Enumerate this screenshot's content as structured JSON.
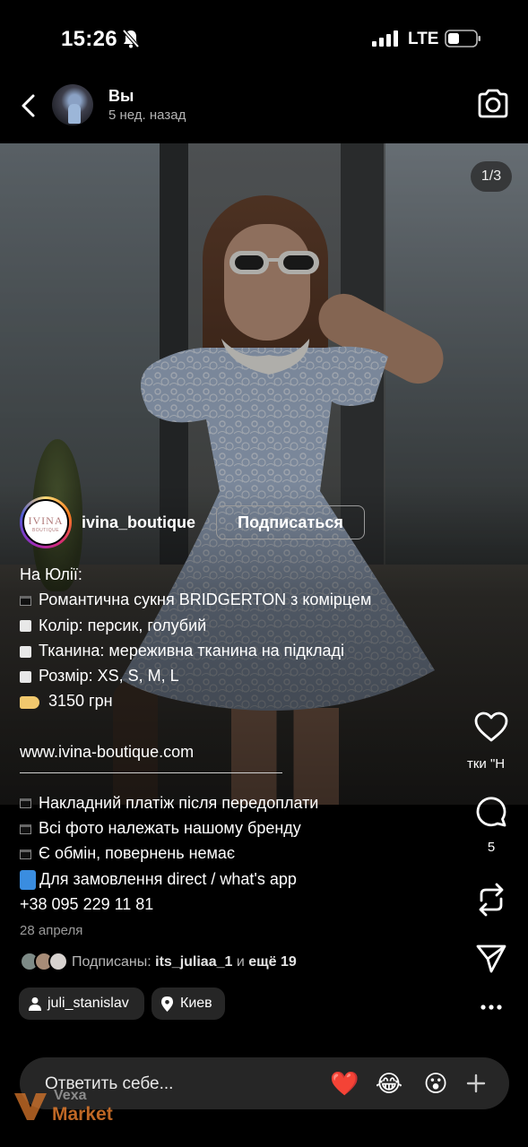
{
  "status_bar": {
    "time": "15:26",
    "network": "LTE"
  },
  "header": {
    "name": "Вы",
    "subtitle": "5 нед. назад"
  },
  "photo": {
    "counter": "1/3"
  },
  "account": {
    "logo_text": "IVINA",
    "logo_subtext": "BOUTIQUE",
    "name": "ivina_boutique",
    "follow_label": "Подписаться"
  },
  "caption": {
    "lines": [
      {
        "icon": "",
        "text": "На Юлії:"
      },
      {
        "icon": "black-square",
        "text": "Романтична сукня BRIDGERTON з комірцем"
      },
      {
        "icon": "white-square",
        "text": "Колір: персик, голубий"
      },
      {
        "icon": "white-square",
        "text": "Тканина: мереживна тканина на підкладі"
      },
      {
        "icon": "white-square",
        "text": "Розмір: XS, S, M, L"
      },
      {
        "icon": "price-tag",
        "text": "3150 грн"
      },
      {
        "icon": "",
        "text": ""
      },
      {
        "icon": "",
        "text": "www.ivina-boutique.com"
      },
      {
        "icon": "",
        "text": ""
      },
      {
        "icon": "black-square",
        "text": "Накладний платіж після передоплати"
      },
      {
        "icon": "black-square",
        "text": "Всі фото належать нашому бренду"
      },
      {
        "icon": "black-square",
        "text": "Є обмін, повернень немає"
      },
      {
        "icon": "mobile-phone",
        "text": "Для замовлення direct / what's app"
      },
      {
        "icon": "",
        "text": "+38 095 229 11 81"
      }
    ]
  },
  "date": "28 апреля",
  "followers": {
    "prefix": "Подписаны:",
    "user": "its_juliaa_1",
    "middle": "и",
    "rest": "ещё 19"
  },
  "chips": {
    "user": "juli_stanislav",
    "location": "Киев"
  },
  "actions": {
    "like_label": "тки \"Н",
    "comments_count": "5"
  },
  "reply": {
    "placeholder": "Ответить себе...",
    "emojis": [
      "❤️",
      "😂",
      "😮"
    ]
  },
  "watermark": {
    "line1": "Vexa",
    "line2": "Market"
  }
}
